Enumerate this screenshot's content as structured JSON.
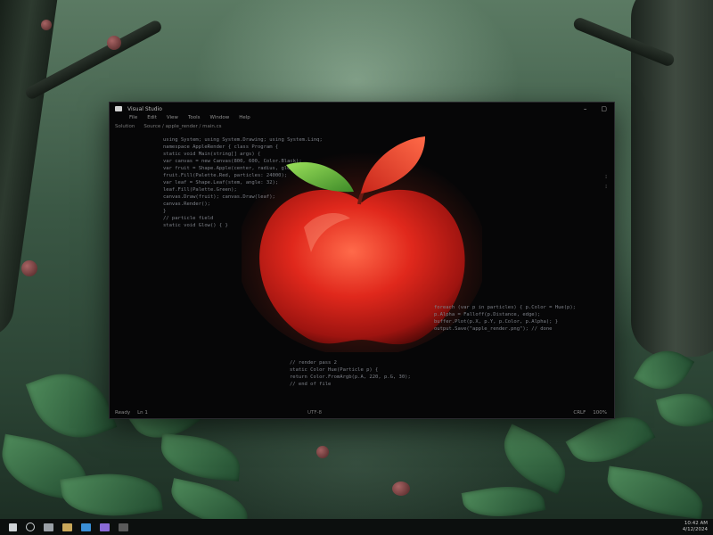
{
  "window": {
    "title": "Visual Studio",
    "menu": [
      "File",
      "Edit",
      "View",
      "Tools",
      "Window",
      "Help"
    ],
    "path": [
      "Solution",
      "Source / apple_render / main.cs"
    ],
    "status_left": [
      "Ready",
      "Ln 1"
    ],
    "status_mid": "UTF-8",
    "status_right": [
      "CRLF",
      "100%"
    ]
  },
  "code": {
    "top": [
      "using System; using System.Drawing; using System.Linq;",
      "namespace AppleRender { class Program {",
      "  static void Main(string[] args) {",
      "    var canvas = new Canvas(800, 600, Color.Black);",
      "    var fruit = Shape.Apple(center, radius, glow);",
      "    fruit.Fill(Palette.Red, particles: 24000);",
      "    var leaf = Shape.Leaf(stem, angle: 32);",
      "    leaf.Fill(Palette.Green);",
      "    canvas.Draw(fruit); canvas.Draw(leaf);",
      "    canvas.Render();",
      "  }",
      "  // particle field",
      "  static void Glow() { }"
    ],
    "mid": [
      "foreach (var p in particles) { p.Color = Hue(p);",
      "  p.Alpha = Falloff(p.Distance, edge);",
      "  buffer.Plot(p.X, p.Y, p.Color, p.Alpha); }",
      "output.Save(\"apple_render.png\"); // done"
    ],
    "low": [
      "// render pass 2",
      "static Color Hue(Particle p) {",
      "  return Color.FromArgb(p.A, 220, p.G, 30);",
      "  // end of file"
    ]
  },
  "taskbar": {
    "time": "10:42 AM",
    "date": "4/12/2024"
  },
  "colors": {
    "window_bg": "#060607",
    "apple_red": "#d8261c",
    "leaf_green": "#58b23a"
  }
}
